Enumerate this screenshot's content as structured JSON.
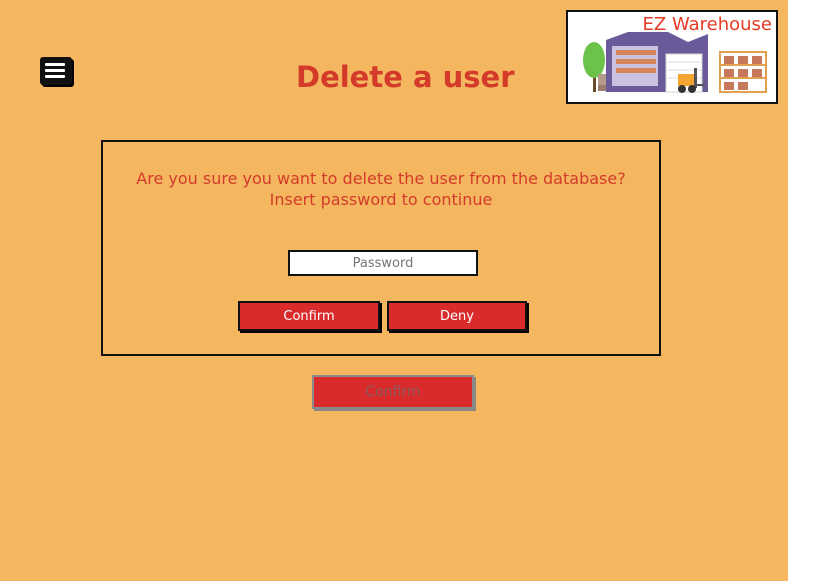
{
  "header": {
    "title": "Delete a user",
    "menu_icon": "hamburger-menu-icon"
  },
  "logo": {
    "text": "EZ Warehouse",
    "image": "warehouse-illustration"
  },
  "dialog": {
    "message_line1": "Are you sure you want to delete the user from the database?",
    "message_line2": "Insert password to continue",
    "password_placeholder": "Password",
    "confirm_label": "Confirm",
    "deny_label": "Deny"
  },
  "footer": {
    "confirm_label": "Confirm",
    "confirm_state": "disabled"
  },
  "colors": {
    "background": "#f4b760",
    "accent": "#d92b2b",
    "title_red": "#d43a2a"
  }
}
